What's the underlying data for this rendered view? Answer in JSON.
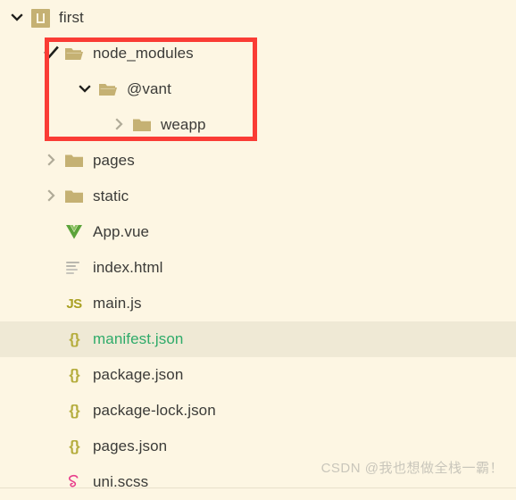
{
  "window": {
    "background_color": "#fdf6e3",
    "selection_color": "#efe9d5",
    "text_color": "#3b3b38",
    "modified_file_color": "#2fab6a",
    "folder_color": "#c5b173",
    "annotation_color": "#fa3c35"
  },
  "tree": {
    "rows": [
      {
        "name": "first",
        "icon": "uniapp-project-icon",
        "twisty": "chevron-down",
        "depth": 0,
        "selected": false,
        "modified": false
      },
      {
        "name": "node_modules",
        "icon": "folder-open-icon",
        "twisty": "check",
        "depth": 1,
        "selected": false,
        "modified": false
      },
      {
        "name": "@vant",
        "icon": "folder-open-icon",
        "twisty": "chevron-down",
        "depth": 2,
        "selected": false,
        "modified": false
      },
      {
        "name": "weapp",
        "icon": "folder-closed-icon",
        "twisty": "chevron-right",
        "depth": 3,
        "selected": false,
        "modified": false
      },
      {
        "name": "pages",
        "icon": "folder-closed-icon",
        "twisty": "chevron-right",
        "depth": 1,
        "selected": false,
        "modified": false
      },
      {
        "name": "static",
        "icon": "folder-closed-icon",
        "twisty": "chevron-right",
        "depth": 1,
        "selected": false,
        "modified": false
      },
      {
        "name": "App.vue",
        "icon": "vue-file-icon",
        "twisty": "none",
        "depth": 1,
        "selected": false,
        "modified": false
      },
      {
        "name": "index.html",
        "icon": "html-file-icon",
        "twisty": "none",
        "depth": 1,
        "selected": false,
        "modified": false
      },
      {
        "name": "main.js",
        "icon": "js-file-icon",
        "icon_text": "JS",
        "twisty": "none",
        "depth": 1,
        "selected": false,
        "modified": false
      },
      {
        "name": "manifest.json",
        "icon": "json-file-icon",
        "icon_text": "{}",
        "twisty": "none",
        "depth": 1,
        "selected": true,
        "modified": true
      },
      {
        "name": "package.json",
        "icon": "json-file-icon",
        "icon_text": "{}",
        "twisty": "none",
        "depth": 1,
        "selected": false,
        "modified": false
      },
      {
        "name": "package-lock.json",
        "icon": "json-file-icon",
        "icon_text": "{}",
        "twisty": "none",
        "depth": 1,
        "selected": false,
        "modified": false
      },
      {
        "name": "pages.json",
        "icon": "json-file-icon",
        "icon_text": "{}",
        "twisty": "none",
        "depth": 1,
        "selected": false,
        "modified": false
      },
      {
        "name": "uni.scss",
        "icon": "sass-file-icon",
        "twisty": "none",
        "depth": 1,
        "selected": false,
        "modified": false
      }
    ]
  },
  "annotation": {
    "type": "red-rectangle-highlight",
    "covers": [
      "node_modules",
      "@vant",
      "weapp"
    ]
  },
  "watermark": {
    "text": "CSDN @我也想做全栈一霸！"
  }
}
